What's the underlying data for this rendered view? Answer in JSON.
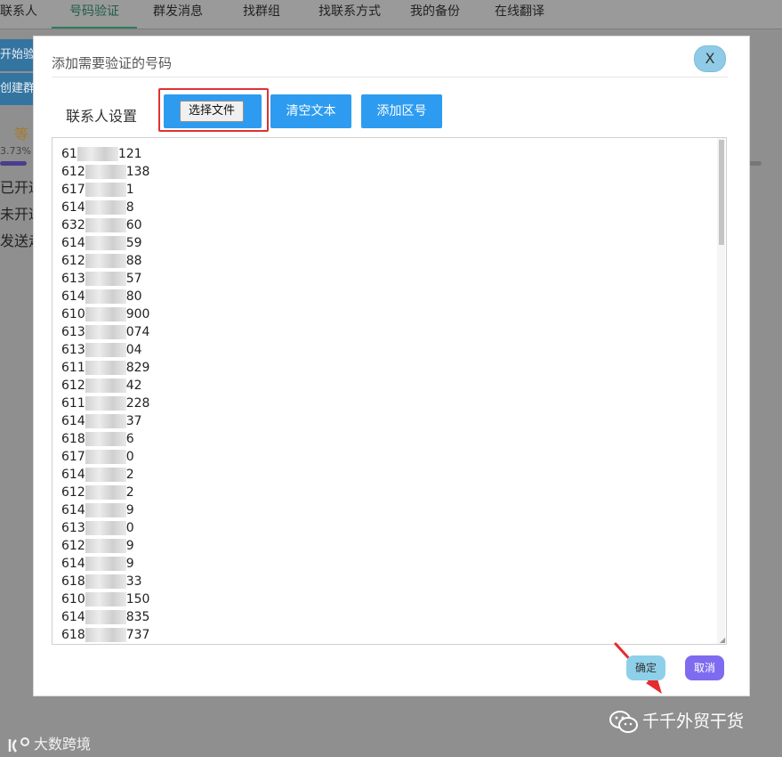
{
  "top_nav": {
    "tabs": [
      {
        "label": "联系人"
      },
      {
        "label": "号码验证",
        "active": true
      },
      {
        "label": "群发消息"
      },
      {
        "label": "找群组"
      },
      {
        "label": "找联系方式"
      },
      {
        "label": "我的备份"
      },
      {
        "label": "在线翻译"
      }
    ]
  },
  "background": {
    "start_verify": "开始验",
    "create_group": "创建群",
    "wait": "等",
    "progress_pct": "3.73%",
    "status_lines": [
      "已开通",
      "未开通",
      "发送走"
    ]
  },
  "modal": {
    "title": "添加需要验证的号码",
    "close_label": "X",
    "contact_label": "联系人设置",
    "choose_file_label": "选择文件",
    "clear_text_label": "清空文本",
    "add_area_code_label": "添加区号",
    "numbers": [
      {
        "prefix": "61",
        "suffix": "121"
      },
      {
        "prefix": "612",
        "suffix": "138"
      },
      {
        "prefix": "617",
        "suffix": "1"
      },
      {
        "prefix": "614",
        "suffix": "8"
      },
      {
        "prefix": "632",
        "suffix": "60"
      },
      {
        "prefix": "614",
        "suffix": "59"
      },
      {
        "prefix": "612",
        "suffix": "88"
      },
      {
        "prefix": "613",
        "suffix": "57"
      },
      {
        "prefix": "614",
        "suffix": "80"
      },
      {
        "prefix": "610",
        "suffix": "900"
      },
      {
        "prefix": "613",
        "suffix": "074"
      },
      {
        "prefix": "613",
        "suffix": "04"
      },
      {
        "prefix": "611",
        "suffix": "829"
      },
      {
        "prefix": "612",
        "suffix": "42"
      },
      {
        "prefix": "611",
        "suffix": "228"
      },
      {
        "prefix": "614",
        "suffix": "37"
      },
      {
        "prefix": "618",
        "suffix": "6"
      },
      {
        "prefix": "617",
        "suffix": "0"
      },
      {
        "prefix": "614",
        "suffix": "2"
      },
      {
        "prefix": "612",
        "suffix": "2"
      },
      {
        "prefix": "614",
        "suffix": "9"
      },
      {
        "prefix": "613",
        "suffix": "0"
      },
      {
        "prefix": "612",
        "suffix": "9"
      },
      {
        "prefix": "614",
        "suffix": "9"
      },
      {
        "prefix": "618",
        "suffix": "33"
      },
      {
        "prefix": "610",
        "suffix": "150"
      },
      {
        "prefix": "614",
        "suffix": "835"
      },
      {
        "prefix": "618",
        "suffix": "737"
      }
    ],
    "confirm_label": "确定",
    "cancel_label": "取消"
  },
  "watermarks": {
    "left": "大数跨境",
    "right": "千千外贸干货"
  },
  "colors": {
    "primary_blue": "#2d9cf0",
    "highlight_red": "#e03131",
    "confirm": "#8ed0ea",
    "cancel": "#7d6cf0"
  }
}
